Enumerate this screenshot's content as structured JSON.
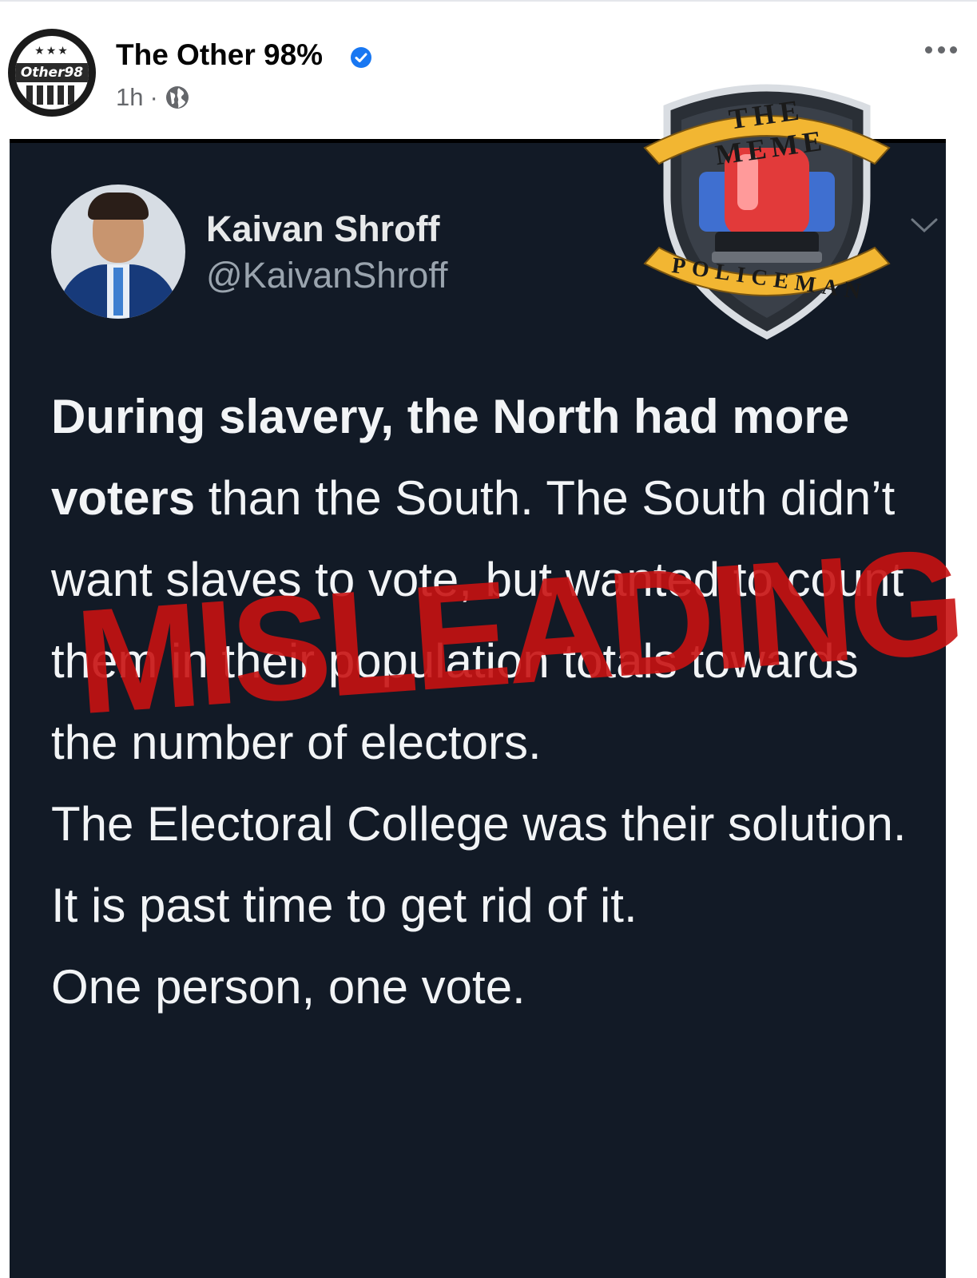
{
  "post": {
    "page_name": "The Other 98%",
    "timestamp": "1h",
    "separator": "·",
    "avatar_text": "Other98",
    "avatar_stars": "★★★"
  },
  "tweet": {
    "author_name": "Kaivan Shroff",
    "author_handle": "@KaivanShroff",
    "paragraph1_bold": "During slavery, the North had more voters",
    "paragraph1_rest": " than the South. The South didn’t want slaves to vote, but wanted to count them in their population totals towards the number of electors.",
    "paragraph2": "The Electoral College was their solution.",
    "paragraph3": "It is past time to get rid of it.",
    "paragraph4": "One person, one vote."
  },
  "overlay": {
    "stamp_text": "MISLEADING",
    "stamp_color": "#c81212",
    "badge_top": "THE MEME",
    "badge_bottom": "POLICEMAN"
  },
  "icons": {
    "verified": "verified-badge-icon",
    "audience": "globe-icon",
    "more": "more-dots-icon",
    "tweet_menu": "chevron-down-icon"
  },
  "colors": {
    "facebook_blue": "#1877f2",
    "tweet_bg": "#121a26",
    "meta_gray": "#65676b"
  }
}
